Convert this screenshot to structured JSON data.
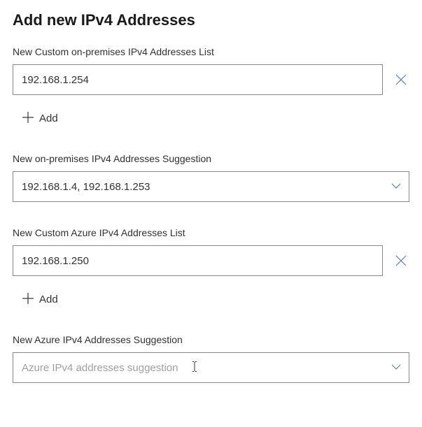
{
  "title": "Add new IPv4 Addresses",
  "sections": {
    "custom_onprem": {
      "label": "New Custom on-premises IPv4 Addresses List",
      "value": "192.168.1.254",
      "add_label": "Add"
    },
    "onprem_suggestion": {
      "label": "New on-premises IPv4 Addresses Suggestion",
      "value": "192.168.1.4, 192.168.1.253"
    },
    "custom_azure": {
      "label": "New Custom Azure IPv4 Addresses List",
      "value": "192.168.1.250",
      "add_label": "Add"
    },
    "azure_suggestion": {
      "label": "New Azure IPv4 Addresses Suggestion",
      "value": "",
      "placeholder": "Azure IPv4 addresses suggestion"
    }
  },
  "colors": {
    "accent": "#5b7ea8",
    "border": "#8a8886",
    "text": "#323130",
    "placeholder": "#a19f9d"
  }
}
